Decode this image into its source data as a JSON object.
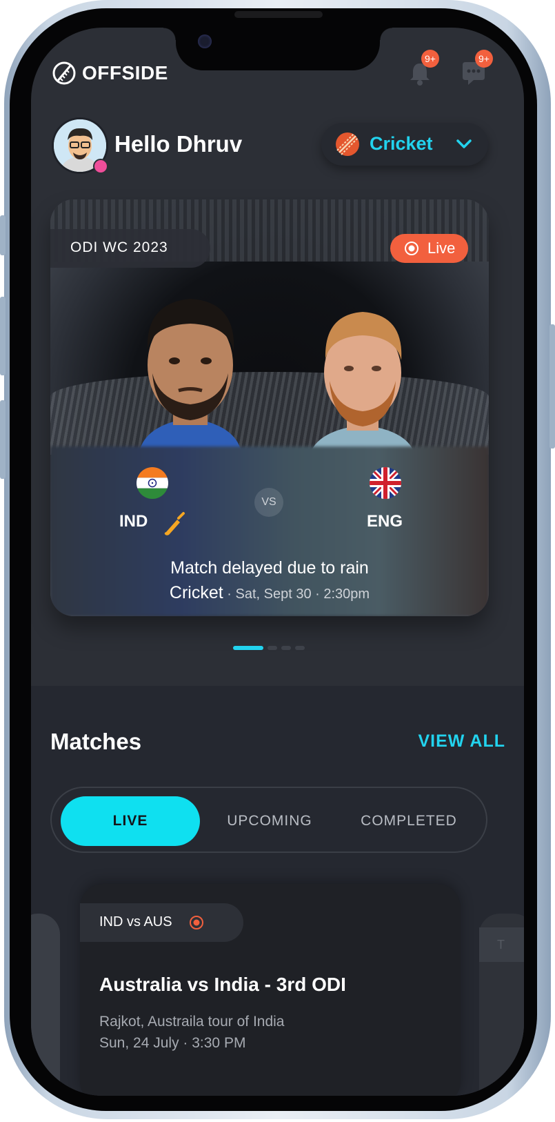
{
  "app": {
    "name": "OFFSIDE"
  },
  "header": {
    "notifications_badge": "9+",
    "messages_badge": "9+"
  },
  "greeting": {
    "text": "Hello Dhruv"
  },
  "sport_selector": {
    "selected": "Cricket"
  },
  "hero": {
    "tournament": "ODI WC 2023",
    "live_label": "Live",
    "team_home": "IND",
    "team_away": "ENG",
    "vs": "VS",
    "status": "Match delayed due to rain",
    "sport": "Cricket",
    "date": "Sat, Sept 30",
    "time": "2:30pm",
    "separator": "·"
  },
  "carousel": {
    "count": 4,
    "active_index": 0
  },
  "matches": {
    "title": "Matches",
    "view_all": "VIEW ALL",
    "tabs": [
      {
        "label": "LIVE",
        "active": true
      },
      {
        "label": "UPCOMING",
        "active": false
      },
      {
        "label": "COMPLETED",
        "active": false
      }
    ],
    "card": {
      "tag": "IND vs AUS",
      "title": "Australia vs India - 3rd ODI",
      "location": "Rajkot, Austraila tour of India",
      "datetime": "Sun, 24 July · 3:30 PM"
    },
    "next_card_peek": "T"
  },
  "colors": {
    "accent": "#22d3ee",
    "live": "#f2603e",
    "background": "#2c2f36",
    "section_bg": "#252830"
  }
}
